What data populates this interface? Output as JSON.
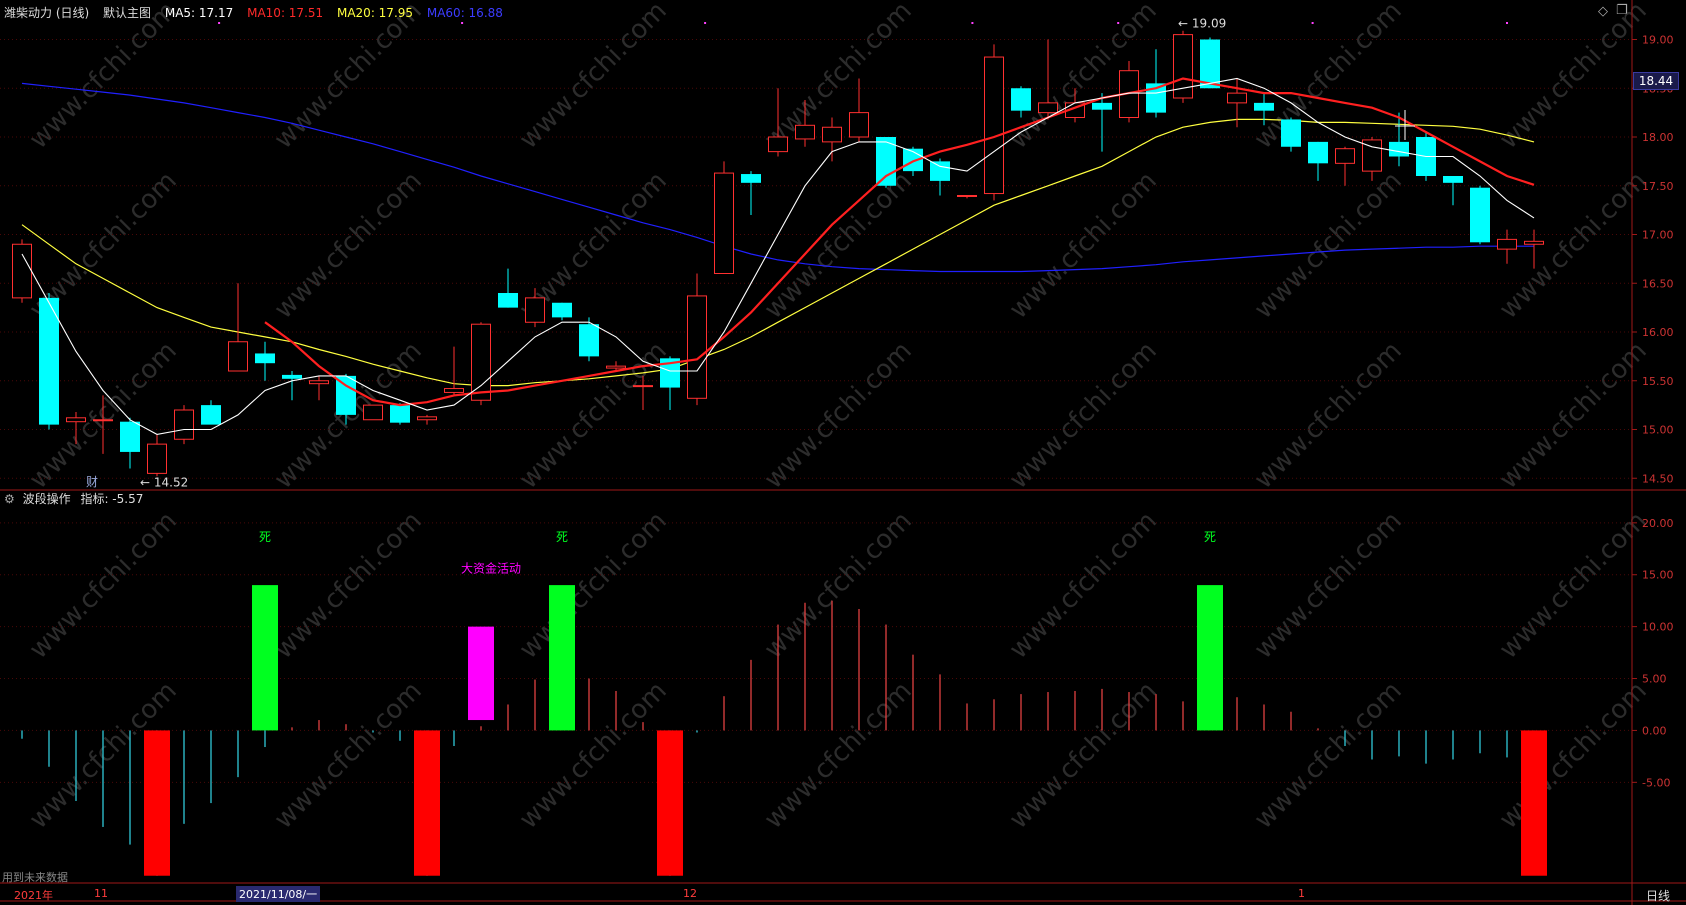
{
  "header": {
    "title": "潍柴动力 (日线)",
    "template": "默认主图",
    "ma5": "MA5: 17.17",
    "ma10": "MA10: 17.51",
    "ma20": "MA20: 17.95",
    "ma60": "MA60: 16.88"
  },
  "indicator_header": {
    "name": "波段操作",
    "value_label": "指标: -5.57"
  },
  "current_price_tag": "18.44",
  "period_button": "日线",
  "future_data_note": "用到未来数据",
  "date_axis": {
    "year_label": "2021年",
    "month_11": "11",
    "cursor_date": "2021/11/08/一",
    "month_12": "12",
    "month_1": "1"
  },
  "annotations": {
    "high_label": "19.09",
    "low_label": "14.52",
    "cai_label": "财",
    "si_label": "死",
    "big_money_label": "大资金活动"
  },
  "colors": {
    "up": "#ff3030",
    "down": "#00ffff",
    "ma5": "#ffffff",
    "ma10": "#ff2020",
    "ma20": "#ffff40",
    "ma60": "#2020ff",
    "signal_green": "#00ff20",
    "signal_red": "#ff0000",
    "signal_magenta": "#ff00ff"
  },
  "chart_data": [
    {
      "type": "candlestick",
      "title": "潍柴动力 (日线)",
      "y_ticks": [
        19.0,
        18.5,
        18.0,
        17.5,
        17.0,
        16.5,
        16.0,
        15.5,
        15.0,
        14.5
      ],
      "ylim": [
        14.4,
        19.2
      ],
      "candles": [
        {
          "o": 16.35,
          "h": 16.95,
          "l": 16.3,
          "c": 16.9
        },
        {
          "o": 16.35,
          "h": 16.4,
          "l": 15.0,
          "c": 15.05
        },
        {
          "o": 15.08,
          "h": 15.18,
          "l": 14.85,
          "c": 15.12
        },
        {
          "o": 15.1,
          "h": 15.35,
          "l": 14.75,
          "c": 15.1
        },
        {
          "o": 15.08,
          "h": 15.12,
          "l": 14.6,
          "c": 14.77
        },
        {
          "o": 14.55,
          "h": 14.95,
          "l": 14.52,
          "c": 14.85
        },
        {
          "o": 14.9,
          "h": 15.25,
          "l": 14.85,
          "c": 15.2
        },
        {
          "o": 15.25,
          "h": 15.3,
          "l": 15.1,
          "c": 15.05
        },
        {
          "o": 15.6,
          "h": 16.5,
          "l": 15.6,
          "c": 15.9
        },
        {
          "o": 15.78,
          "h": 15.9,
          "l": 15.5,
          "c": 15.68
        },
        {
          "o": 15.56,
          "h": 15.6,
          "l": 15.3,
          "c": 15.52
        },
        {
          "o": 15.47,
          "h": 15.55,
          "l": 15.3,
          "c": 15.5
        },
        {
          "o": 15.55,
          "h": 15.57,
          "l": 15.05,
          "c": 15.15
        },
        {
          "o": 15.1,
          "h": 15.25,
          "l": 15.1,
          "c": 15.25
        },
        {
          "o": 15.25,
          "h": 15.27,
          "l": 15.05,
          "c": 15.07
        },
        {
          "o": 15.1,
          "h": 15.15,
          "l": 15.05,
          "c": 15.13
        },
        {
          "o": 15.38,
          "h": 15.85,
          "l": 15.35,
          "c": 15.42
        },
        {
          "o": 15.3,
          "h": 16.1,
          "l": 15.25,
          "c": 16.08
        },
        {
          "o": 16.4,
          "h": 16.65,
          "l": 16.25,
          "c": 16.25
        },
        {
          "o": 16.1,
          "h": 16.45,
          "l": 16.05,
          "c": 16.35
        },
        {
          "o": 16.3,
          "h": 16.3,
          "l": 16.12,
          "c": 16.15
        },
        {
          "o": 16.08,
          "h": 16.15,
          "l": 15.7,
          "c": 15.75
        },
        {
          "o": 15.63,
          "h": 15.7,
          "l": 15.6,
          "c": 15.65
        },
        {
          "o": 15.45,
          "h": 15.55,
          "l": 15.2,
          "c": 15.45
        },
        {
          "o": 15.73,
          "h": 15.75,
          "l": 15.2,
          "c": 15.43
        },
        {
          "o": 15.32,
          "h": 16.6,
          "l": 15.25,
          "c": 16.37
        },
        {
          "o": 16.6,
          "h": 17.75,
          "l": 16.6,
          "c": 17.63
        },
        {
          "o": 17.62,
          "h": 17.65,
          "l": 17.2,
          "c": 17.53
        },
        {
          "o": 17.85,
          "h": 18.5,
          "l": 17.8,
          "c": 18.0
        },
        {
          "o": 17.98,
          "h": 18.38,
          "l": 17.9,
          "c": 18.12
        },
        {
          "o": 17.95,
          "h": 18.2,
          "l": 17.75,
          "c": 18.1
        },
        {
          "o": 18.0,
          "h": 18.6,
          "l": 17.95,
          "c": 18.25
        },
        {
          "o": 18.0,
          "h": 18.0,
          "l": 17.48,
          "c": 17.5
        },
        {
          "o": 17.88,
          "h": 17.9,
          "l": 17.6,
          "c": 17.65
        },
        {
          "o": 17.75,
          "h": 17.78,
          "l": 17.4,
          "c": 17.55
        },
        {
          "o": 17.4,
          "h": 17.4,
          "l": 17.37,
          "c": 17.4
        },
        {
          "o": 17.42,
          "h": 18.95,
          "l": 17.35,
          "c": 18.82
        },
        {
          "o": 18.5,
          "h": 18.52,
          "l": 18.2,
          "c": 18.27
        },
        {
          "o": 18.25,
          "h": 19.0,
          "l": 18.18,
          "c": 18.35
        },
        {
          "o": 18.2,
          "h": 18.5,
          "l": 18.15,
          "c": 18.35
        },
        {
          "o": 18.35,
          "h": 18.45,
          "l": 17.85,
          "c": 18.28
        },
        {
          "o": 18.2,
          "h": 18.78,
          "l": 18.15,
          "c": 18.68
        },
        {
          "o": 18.55,
          "h": 18.9,
          "l": 18.2,
          "c": 18.25
        },
        {
          "o": 18.4,
          "h": 19.09,
          "l": 18.35,
          "c": 19.05
        },
        {
          "o": 19.0,
          "h": 19.02,
          "l": 18.5,
          "c": 18.5
        },
        {
          "o": 18.35,
          "h": 18.6,
          "l": 18.1,
          "c": 18.45
        },
        {
          "o": 18.35,
          "h": 18.45,
          "l": 18.12,
          "c": 18.27
        },
        {
          "o": 18.18,
          "h": 18.2,
          "l": 17.85,
          "c": 17.9
        },
        {
          "o": 17.95,
          "h": 17.95,
          "l": 17.55,
          "c": 17.73
        },
        {
          "o": 17.73,
          "h": 17.9,
          "l": 17.5,
          "c": 17.88
        },
        {
          "o": 17.65,
          "h": 18.0,
          "l": 17.55,
          "c": 17.97
        },
        {
          "o": 17.95,
          "h": 18.25,
          "l": 17.7,
          "c": 17.8
        },
        {
          "o": 18.0,
          "h": 18.05,
          "l": 17.55,
          "c": 17.6
        },
        {
          "o": 17.6,
          "h": 17.6,
          "l": 17.3,
          "c": 17.53
        },
        {
          "o": 17.48,
          "h": 17.5,
          "l": 16.9,
          "c": 16.92
        },
        {
          "o": 16.85,
          "h": 17.05,
          "l": 16.7,
          "c": 16.95
        },
        {
          "o": 16.9,
          "h": 17.05,
          "l": 16.65,
          "c": 16.93
        }
      ],
      "ma5": [
        16.8,
        16.3,
        15.8,
        15.4,
        15.1,
        14.95,
        15.0,
        15.0,
        15.15,
        15.4,
        15.5,
        15.55,
        15.55,
        15.4,
        15.3,
        15.2,
        15.25,
        15.45,
        15.7,
        15.95,
        16.1,
        16.1,
        15.95,
        15.7,
        15.6,
        15.6,
        16.0,
        16.5,
        17.0,
        17.5,
        17.85,
        17.95,
        17.95,
        17.85,
        17.7,
        17.65,
        17.85,
        18.05,
        18.2,
        18.35,
        18.4,
        18.45,
        18.45,
        18.5,
        18.55,
        18.6,
        18.5,
        18.35,
        18.15,
        18.0,
        17.9,
        17.85,
        17.8,
        17.8,
        17.6,
        17.35,
        17.17
      ],
      "ma10": [
        null,
        null,
        null,
        null,
        null,
        null,
        null,
        null,
        null,
        16.1,
        15.9,
        15.65,
        15.45,
        15.3,
        15.25,
        15.28,
        15.35,
        15.38,
        15.4,
        15.45,
        15.5,
        15.55,
        15.6,
        15.65,
        15.68,
        15.72,
        15.95,
        16.2,
        16.5,
        16.8,
        17.1,
        17.35,
        17.6,
        17.75,
        17.85,
        17.92,
        18.0,
        18.1,
        18.2,
        18.3,
        18.4,
        18.45,
        18.5,
        18.6,
        18.55,
        18.5,
        18.45,
        18.45,
        18.4,
        18.35,
        18.3,
        18.2,
        18.05,
        17.9,
        17.75,
        17.6,
        17.51
      ],
      "ma20": [
        17.1,
        16.9,
        16.7,
        16.55,
        16.4,
        16.25,
        16.15,
        16.05,
        16.0,
        15.95,
        15.9,
        15.82,
        15.75,
        15.67,
        15.6,
        15.53,
        15.47,
        15.45,
        15.45,
        15.48,
        15.5,
        15.52,
        15.55,
        15.58,
        15.62,
        15.72,
        15.82,
        15.95,
        16.1,
        16.25,
        16.4,
        16.55,
        16.7,
        16.85,
        17.0,
        17.15,
        17.3,
        17.4,
        17.5,
        17.6,
        17.7,
        17.85,
        18.0,
        18.1,
        18.15,
        18.18,
        18.18,
        18.17,
        18.15,
        18.15,
        18.14,
        18.13,
        18.12,
        18.11,
        18.08,
        18.02,
        17.95
      ],
      "ma60": [
        18.55,
        18.52,
        18.49,
        18.46,
        18.43,
        18.39,
        18.35,
        18.3,
        18.25,
        18.2,
        18.14,
        18.07,
        18.0,
        17.93,
        17.85,
        17.77,
        17.69,
        17.6,
        17.52,
        17.44,
        17.36,
        17.28,
        17.2,
        17.12,
        17.05,
        16.97,
        16.88,
        16.8,
        16.74,
        16.7,
        16.67,
        16.65,
        16.64,
        16.63,
        16.62,
        16.62,
        16.62,
        16.62,
        16.63,
        16.64,
        16.65,
        16.67,
        16.69,
        16.72,
        16.74,
        16.76,
        16.78,
        16.8,
        16.82,
        16.84,
        16.85,
        16.86,
        16.87,
        16.87,
        16.88,
        16.88,
        16.88
      ]
    },
    {
      "type": "bar",
      "title": "波段操作",
      "y_ticks": [
        20.0,
        15.0,
        10.0,
        5.0,
        0.0,
        -5.0
      ],
      "ylim": [
        -14.7,
        22.2
      ],
      "values": [
        -0.8,
        -3.5,
        -6.8,
        -9.3,
        -11.0,
        -14.0,
        -9.0,
        -7.0,
        -4.5,
        -1.6,
        0.3,
        1.0,
        0.6,
        -0.2,
        -1.0,
        -14.0,
        -1.5,
        0.4,
        2.5,
        4.9,
        0.5,
        5.0,
        3.8,
        0.8,
        -14.0,
        -0.2,
        3.3,
        6.8,
        10.2,
        12.3,
        12.5,
        11.7,
        10.2,
        7.3,
        5.4,
        2.6,
        3.0,
        3.5,
        3.7,
        3.8,
        4.0,
        3.7,
        3.5,
        2.8,
        3.0,
        3.2,
        2.5,
        1.8,
        0.2,
        -1.5,
        -2.8,
        -2.5,
        -3.2,
        -2.8,
        -2.2,
        -2.6,
        -5.57
      ],
      "signals": [
        {
          "index": 9,
          "kind": "green",
          "value": 14.0,
          "label": "死"
        },
        {
          "index": 17,
          "kind": "magenta",
          "from": 1.0,
          "to": 10.0,
          "label": "大资金活动"
        },
        {
          "index": 20,
          "kind": "green",
          "value": 14.0,
          "label": "死"
        },
        {
          "index": 44,
          "kind": "green",
          "value": 14.0,
          "label": "死"
        },
        {
          "index": 5,
          "kind": "red",
          "value": -14.0
        },
        {
          "index": 15,
          "kind": "red",
          "value": -14.0
        },
        {
          "index": 24,
          "kind": "red",
          "value": -14.0
        },
        {
          "index": 56,
          "kind": "red",
          "value": -14.0
        }
      ]
    }
  ]
}
